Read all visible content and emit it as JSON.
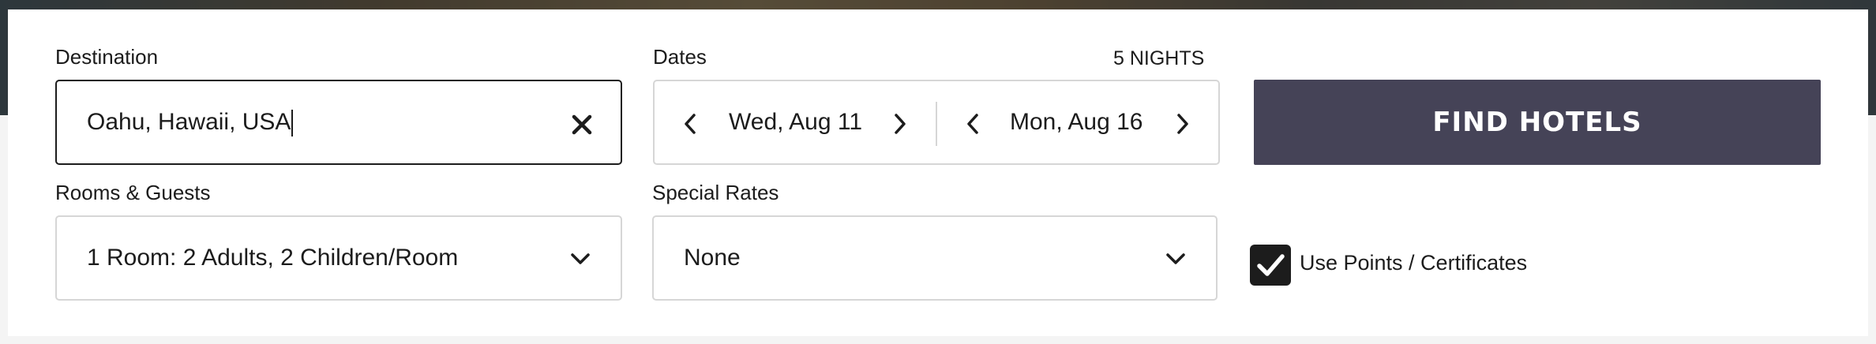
{
  "destination": {
    "label": "Destination",
    "value": "Oahu, Hawaii, USA",
    "clear_icon": "close-icon"
  },
  "dates": {
    "label": "Dates",
    "nights": "5 NIGHTS",
    "checkin": "Wed, Aug 11",
    "checkout": "Mon, Aug 16",
    "prev_icon": "chevron-left-icon",
    "next_icon": "chevron-right-icon"
  },
  "search": {
    "button_label": "FIND HOTELS"
  },
  "rooms_guests": {
    "label": "Rooms & Guests",
    "value": "1 Room: 2 Adults, 2 Children/Room",
    "icon": "chevron-down-icon"
  },
  "special_rates": {
    "label": "Special Rates",
    "value": "None",
    "icon": "chevron-down-icon"
  },
  "points": {
    "label": "Use Points / Certificates",
    "checked": true
  },
  "colors": {
    "button_bg": "#454357",
    "text": "#1c1c1c",
    "border": "#d6d6d6",
    "checkbox": "#1c1c1c"
  }
}
